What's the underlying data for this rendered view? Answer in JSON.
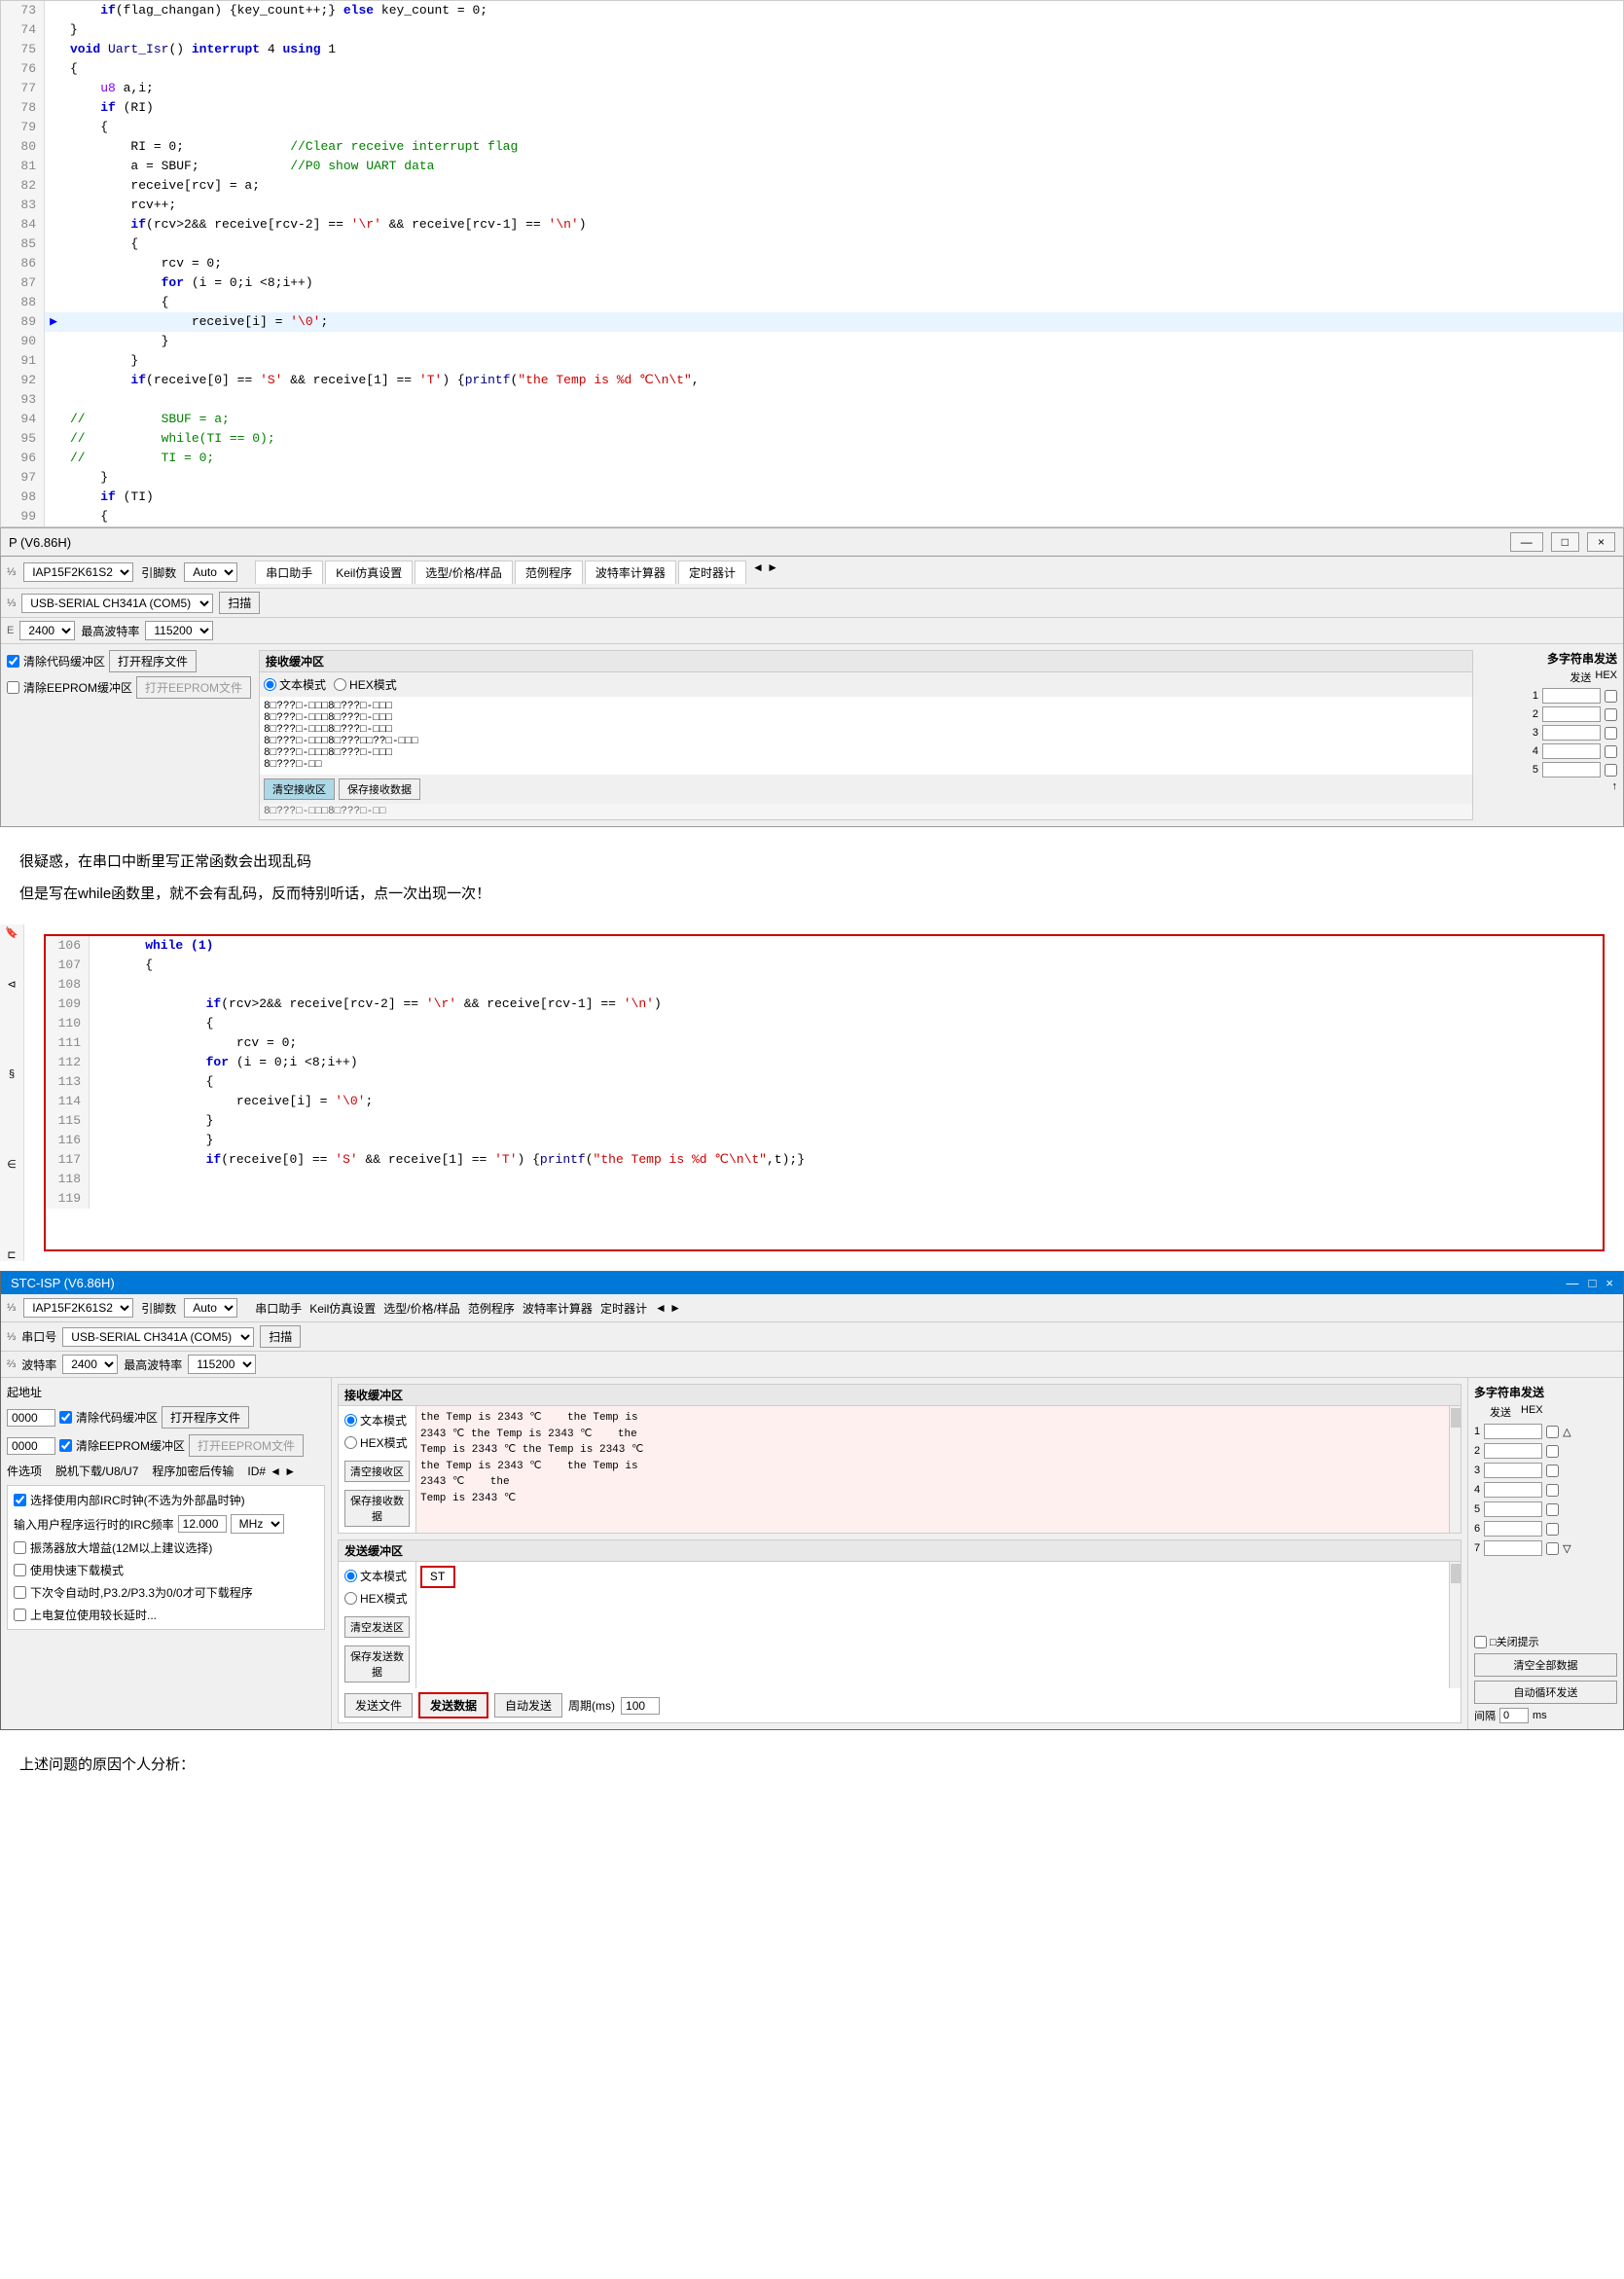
{
  "editor": {
    "lines": [
      {
        "num": "73",
        "content": "    if(flag_changan) {key_count++;} else key_count = 0;",
        "arrow": false
      },
      {
        "num": "74",
        "content": "}",
        "arrow": false
      },
      {
        "num": "75",
        "content": "void Uart_Isr() interrupt 4 using 1",
        "arrow": false
      },
      {
        "num": "76",
        "content": "{",
        "arrow": false
      },
      {
        "num": "77",
        "content": "    u8 a,i;",
        "arrow": false
      },
      {
        "num": "78",
        "content": "    if (RI)",
        "arrow": false
      },
      {
        "num": "79",
        "content": "    {",
        "arrow": false
      },
      {
        "num": "80",
        "content": "        RI = 0;              //Clear receive interrupt flag",
        "arrow": false
      },
      {
        "num": "81",
        "content": "        a = SBUF;            //P0 show UART data",
        "arrow": false
      },
      {
        "num": "82",
        "content": "        receive[rcv] = a;",
        "arrow": false
      },
      {
        "num": "83",
        "content": "        rcv++;",
        "arrow": false
      },
      {
        "num": "84",
        "content": "        if(rcv>2&& receive[rcv-2] == '\\r' && receive[rcv-1] == '\\n')",
        "arrow": false
      },
      {
        "num": "85",
        "content": "        {",
        "arrow": false
      },
      {
        "num": "86",
        "content": "            rcv = 0;",
        "arrow": false
      },
      {
        "num": "87",
        "content": "            for (i = 0;i <8;i++)",
        "arrow": false
      },
      {
        "num": "88",
        "content": "            {",
        "arrow": false
      },
      {
        "num": "89",
        "content": "                receive[i] = '\\0';",
        "arrow": true
      },
      {
        "num": "90",
        "content": "            }",
        "arrow": false
      },
      {
        "num": "91",
        "content": "        }",
        "arrow": false
      },
      {
        "num": "92",
        "content": "        if(receive[0] == 'S' && receive[1] == 'T') {printf(\"the Temp is %d ℃\\n\\t\",",
        "arrow": false
      },
      {
        "num": "93",
        "content": "",
        "arrow": false
      },
      {
        "num": "94",
        "content": "//          SBUF = a;",
        "arrow": false
      },
      {
        "num": "95",
        "content": "//          while(TI == 0);",
        "arrow": false
      },
      {
        "num": "96",
        "content": "//          TI = 0;",
        "arrow": false
      },
      {
        "num": "97",
        "content": "    }",
        "arrow": false
      },
      {
        "num": "98",
        "content": "    if (TI)",
        "arrow": false
      },
      {
        "num": "99",
        "content": "    {",
        "arrow": false
      }
    ]
  },
  "window1": {
    "title": "P (V6.86H)",
    "controls": [
      "—",
      "□",
      "×"
    ]
  },
  "stc_panel1": {
    "chip_model": "IAP15F2K61S2",
    "引脚数": "Auto",
    "port": "USB-SERIAL CH341A (COM5)",
    "baud": "2400",
    "max_baud": "115200",
    "tabs": [
      "串口助手",
      "Keil仿真设置",
      "选型/价格/样品",
      "范例程序",
      "波特率计算器",
      "定时器计"
    ],
    "recv_area_title": "接收缓冲区",
    "text_mode": "文本模式",
    "hex_mode": "HEX模式",
    "clear_recv": "清空接收区",
    "save_recv": "保存接收数据",
    "recv_content": "8□???□-□□□8□???□-□□□\n8□???□-□□□8□???□-□□□\n8□???□-□□□8□???□-□□□\n8□???□-□□□8□???□□??□-□□□\n8□???□-□□□8□???□-□□□\n8□???□-□□",
    "multi_send_title": "多字符串发送",
    "send_label": "发送",
    "hex_label": "HEX",
    "send_rows": [
      "1",
      "2",
      "3",
      "4",
      "5"
    ],
    "checkboxes": [
      false,
      false,
      false,
      false,
      false
    ],
    "clear_code": "清除代码缓冲区",
    "open_program": "打开程序文件",
    "clear_eeprom": "清除EEPROM缓冲区",
    "open_eeprom": "打开EEPROM文件"
  },
  "text_between": {
    "line1": "很疑惑，在串口中断里写正常函数会出现乱码",
    "line2": "但是写在while函数里，就不会有乱码，反而特别听话，点一次出现一次！"
  },
  "code_block": {
    "lines": [
      {
        "num": "106",
        "content": "    while (1)",
        "indent": 4
      },
      {
        "num": "107",
        "content": "    {",
        "indent": 4
      },
      {
        "num": "108",
        "content": "",
        "indent": 0
      },
      {
        "num": "109",
        "content": "            if(rcv>2&& receive[rcv-2] == '\\r' && receive[rcv-1] == '\\n')",
        "indent": 12
      },
      {
        "num": "110",
        "content": "            {",
        "indent": 12
      },
      {
        "num": "111",
        "content": "                rcv = 0;",
        "indent": 16
      },
      {
        "num": "112",
        "content": "            for (i = 0;i <8;i++)",
        "indent": 12
      },
      {
        "num": "113",
        "content": "            {",
        "indent": 12
      },
      {
        "num": "114",
        "content": "                receive[i] = '\\0';",
        "indent": 16
      },
      {
        "num": "115",
        "content": "            }",
        "indent": 12
      },
      {
        "num": "116",
        "content": "            }",
        "indent": 12
      },
      {
        "num": "117",
        "content": "            if(receive[0] == 'S' && receive[1] == 'T') {printf(\"the Temp is %d ℃\\n\\t\",t);}",
        "indent": 12
      },
      {
        "num": "118",
        "content": "",
        "indent": 0
      },
      {
        "num": "119",
        "content": "",
        "indent": 0
      }
    ]
  },
  "stc_full": {
    "title": "STC-ISP (V6.86H)",
    "chip_model": "IAP15F2K61S2",
    "引脚数": "Auto",
    "port": "USB-SERIAL CH341A (COM5)",
    "baud": "2400",
    "max_baud": "115200",
    "address1": "0000",
    "address2": "0000",
    "clear_code": "清除代码缓冲区",
    "open_program": "打开程序文件",
    "clear_eeprom_cb": true,
    "clear_eeprom": "清除EEPROM缓冲区",
    "open_eeprom": "打开EEPROM文件",
    "options_label": "件选项",
    "download_label": "脱机下载/U8/U7",
    "encrypt_label": "程序加密后传输",
    "id_label": "ID#",
    "tabs": [
      "串口助手",
      "Keil仿真设置",
      "选型/价格/样品",
      "范例程序",
      "波特率计算器",
      "定时器计"
    ],
    "recv_area_title": "接收缓冲区",
    "text_mode": "文本模式",
    "hex_mode": "HEX模式",
    "clear_recv": "清空接收区",
    "save_recv": "保存接收数据",
    "recv_content": "the Temp is 2343 ℃    the Temp is 2343 ℃ the Temp is 2343 ℃ the Temp is 2343 ℃ the Temp is 2343 ℃    the Temp is 2343 ℃    the Temp is 2343 ℃ the Temp is 2343 ℃ the Temp is 2343 ℃    the Temp is 2343 ℃\nTemp is 2343 ℃",
    "send_area_title": "发送缓冲区",
    "send_text_mode": "文本模式",
    "send_hex_mode": "HEX模式",
    "clear_send": "清空发送区",
    "save_send": "保存发送数据",
    "send_file": "发送文件",
    "send_data": "发送数据",
    "auto_send": "自动发送",
    "period_label": "周期(ms)",
    "period_value": "100",
    "send_content": "ST",
    "multi_send_title": "多字符串发送",
    "send_label": "发送",
    "hex_label": "HEX",
    "send_rows": [
      "1",
      "2",
      "3",
      "4",
      "5",
      "6",
      "7"
    ],
    "close_hint": "□关闭提示",
    "clear_all": "清空全部数据",
    "auto_loop": "自动循环发送",
    "interval_label": "间隔",
    "interval_value": "0",
    "interval_unit": "ms",
    "irc_option1": "选择使用内部IRC时钟(不选为外部晶时钟)",
    "irc_freq_label": "输入用户程序运行时的IRC频率",
    "irc_freq_value": "12.000",
    "irc_freq_unit": "MHz",
    "amp_option": "振荡器放大增益(12M以上建议选择)",
    "fast_option": "使用快速下载模式",
    "p3_option": "下次令自动时,P3.2/P3.3为0/0才可下载程序",
    "more_option": "上电复位使用较长延时..."
  },
  "analysis": {
    "title": "上述问题的原因个人分析："
  }
}
